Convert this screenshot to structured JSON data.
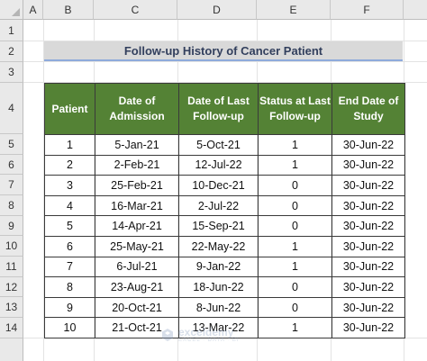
{
  "columns": [
    "A",
    "B",
    "C",
    "D",
    "E",
    "F"
  ],
  "rows": [
    "1",
    "2",
    "3",
    "4",
    "5",
    "6",
    "7",
    "8",
    "9",
    "10",
    "11",
    "12",
    "13",
    "14"
  ],
  "title": "Follow-up History of Cancer Patient",
  "table": {
    "headers": [
      "Patient",
      "Date of Admission",
      "Date of Last Follow-up",
      "Status at Last Follow-up",
      "End Date of Study"
    ],
    "rows": [
      [
        "1",
        "5-Jan-21",
        "5-Oct-21",
        "1",
        "30-Jun-22"
      ],
      [
        "2",
        "2-Feb-21",
        "12-Jul-22",
        "1",
        "30-Jun-22"
      ],
      [
        "3",
        "25-Feb-21",
        "10-Dec-21",
        "0",
        "30-Jun-22"
      ],
      [
        "4",
        "16-Mar-21",
        "2-Jul-22",
        "0",
        "30-Jun-22"
      ],
      [
        "5",
        "14-Apr-21",
        "15-Sep-21",
        "0",
        "30-Jun-22"
      ],
      [
        "6",
        "25-May-21",
        "22-May-22",
        "1",
        "30-Jun-22"
      ],
      [
        "7",
        "6-Jul-21",
        "9-Jan-22",
        "1",
        "30-Jun-22"
      ],
      [
        "8",
        "23-Aug-21",
        "18-Jun-22",
        "0",
        "30-Jun-22"
      ],
      [
        "9",
        "20-Oct-21",
        "8-Jun-22",
        "0",
        "30-Jun-22"
      ],
      [
        "10",
        "21-Oct-21",
        "13-Mar-22",
        "1",
        "30-Jun-22"
      ]
    ]
  },
  "watermark": {
    "name": "exceldemy",
    "tagline": "EXCEL · DATA · BI"
  },
  "colors": {
    "header_fill": "#548235",
    "title_fill": "#d9d9d9",
    "title_text": "#323f5d",
    "title_underline": "#8eaadb"
  }
}
